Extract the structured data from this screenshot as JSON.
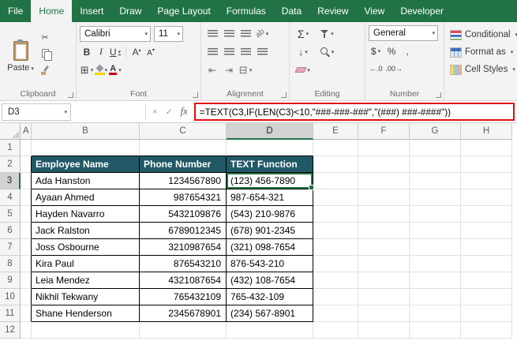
{
  "colors": {
    "excel_green": "#217346",
    "table_header_bg": "#215967",
    "annotation_red": "#e10e0e"
  },
  "ribbon": {
    "tabs": [
      {
        "label": "File"
      },
      {
        "label": "Home"
      },
      {
        "label": "Insert"
      },
      {
        "label": "Draw"
      },
      {
        "label": "Page Layout"
      },
      {
        "label": "Formulas"
      },
      {
        "label": "Data"
      },
      {
        "label": "Review"
      },
      {
        "label": "View"
      },
      {
        "label": "Developer"
      }
    ],
    "active_tab": "Home",
    "clipboard": {
      "label": "Clipboard",
      "paste": "Paste"
    },
    "font": {
      "label": "Font",
      "font_name": "Calibri",
      "font_size": "11",
      "bold": "B",
      "italic": "I",
      "underline": "U"
    },
    "alignment": {
      "label": "Alignment",
      "orientation": "ab"
    },
    "editing": {
      "label": "Editing",
      "autosum": "Σ"
    },
    "number": {
      "label": "Number",
      "format": "General",
      "currency": "$",
      "percent": "%",
      "comma": ","
    },
    "styles": {
      "conditional": "Conditional",
      "format_as": "Format as",
      "cell_styles": "Cell Styles"
    }
  },
  "formula_bar": {
    "name_box": "D3",
    "cancel": "×",
    "enter": "✓",
    "fx": "fx",
    "formula": "=TEXT(C3,IF(LEN(C3)<10,\"###-###-###\",\"(###) ###-####\"))"
  },
  "sheet": {
    "columns": [
      "A",
      "B",
      "C",
      "D",
      "E",
      "F",
      "G",
      "H"
    ],
    "rows": [
      "1",
      "2",
      "3",
      "4",
      "5",
      "6",
      "7",
      "8",
      "9",
      "10",
      "11",
      "12"
    ],
    "selected_cell": "D3",
    "table": {
      "headers": [
        "Employee Name",
        "Phone Number",
        "TEXT Function"
      ],
      "rows": [
        {
          "name": "Ada Hanston",
          "phone": "1234567890",
          "formatted": "(123) 456-7890"
        },
        {
          "name": "Ayaan Ahmed",
          "phone": "987654321",
          "formatted": "987-654-321"
        },
        {
          "name": "Hayden Navarro",
          "phone": "5432109876",
          "formatted": "(543) 210-9876"
        },
        {
          "name": "Jack Ralston",
          "phone": "6789012345",
          "formatted": "(678) 901-2345"
        },
        {
          "name": "Joss Osbourne",
          "phone": "3210987654",
          "formatted": "(321) 098-7654"
        },
        {
          "name": "Kira Paul",
          "phone": "876543210",
          "formatted": "876-543-210"
        },
        {
          "name": "Leia Mendez",
          "phone": "4321087654",
          "formatted": "(432) 108-7654"
        },
        {
          "name": "Nikhil Tekwany",
          "phone": "765432109",
          "formatted": "765-432-109"
        },
        {
          "name": "Shane Henderson",
          "phone": "2345678901",
          "formatted": "(234) 567-8901"
        }
      ]
    }
  }
}
